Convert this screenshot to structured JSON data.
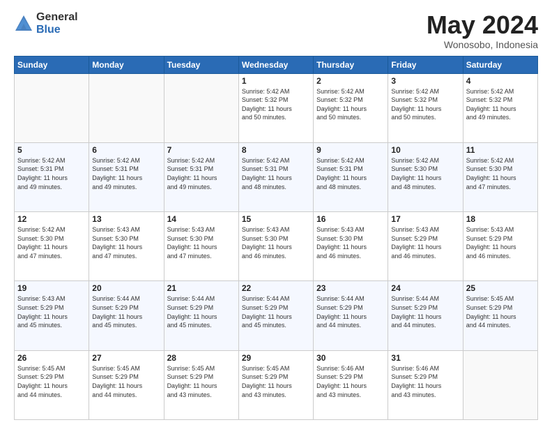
{
  "logo": {
    "general": "General",
    "blue": "Blue"
  },
  "header": {
    "month": "May 2024",
    "location": "Wonosobo, Indonesia"
  },
  "weekdays": [
    "Sunday",
    "Monday",
    "Tuesday",
    "Wednesday",
    "Thursday",
    "Friday",
    "Saturday"
  ],
  "weeks": [
    [
      {
        "day": "",
        "info": ""
      },
      {
        "day": "",
        "info": ""
      },
      {
        "day": "",
        "info": ""
      },
      {
        "day": "1",
        "info": "Sunrise: 5:42 AM\nSunset: 5:32 PM\nDaylight: 11 hours\nand 50 minutes."
      },
      {
        "day": "2",
        "info": "Sunrise: 5:42 AM\nSunset: 5:32 PM\nDaylight: 11 hours\nand 50 minutes."
      },
      {
        "day": "3",
        "info": "Sunrise: 5:42 AM\nSunset: 5:32 PM\nDaylight: 11 hours\nand 50 minutes."
      },
      {
        "day": "4",
        "info": "Sunrise: 5:42 AM\nSunset: 5:32 PM\nDaylight: 11 hours\nand 49 minutes."
      }
    ],
    [
      {
        "day": "5",
        "info": "Sunrise: 5:42 AM\nSunset: 5:31 PM\nDaylight: 11 hours\nand 49 minutes."
      },
      {
        "day": "6",
        "info": "Sunrise: 5:42 AM\nSunset: 5:31 PM\nDaylight: 11 hours\nand 49 minutes."
      },
      {
        "day": "7",
        "info": "Sunrise: 5:42 AM\nSunset: 5:31 PM\nDaylight: 11 hours\nand 49 minutes."
      },
      {
        "day": "8",
        "info": "Sunrise: 5:42 AM\nSunset: 5:31 PM\nDaylight: 11 hours\nand 48 minutes."
      },
      {
        "day": "9",
        "info": "Sunrise: 5:42 AM\nSunset: 5:31 PM\nDaylight: 11 hours\nand 48 minutes."
      },
      {
        "day": "10",
        "info": "Sunrise: 5:42 AM\nSunset: 5:30 PM\nDaylight: 11 hours\nand 48 minutes."
      },
      {
        "day": "11",
        "info": "Sunrise: 5:42 AM\nSunset: 5:30 PM\nDaylight: 11 hours\nand 47 minutes."
      }
    ],
    [
      {
        "day": "12",
        "info": "Sunrise: 5:42 AM\nSunset: 5:30 PM\nDaylight: 11 hours\nand 47 minutes."
      },
      {
        "day": "13",
        "info": "Sunrise: 5:43 AM\nSunset: 5:30 PM\nDaylight: 11 hours\nand 47 minutes."
      },
      {
        "day": "14",
        "info": "Sunrise: 5:43 AM\nSunset: 5:30 PM\nDaylight: 11 hours\nand 47 minutes."
      },
      {
        "day": "15",
        "info": "Sunrise: 5:43 AM\nSunset: 5:30 PM\nDaylight: 11 hours\nand 46 minutes."
      },
      {
        "day": "16",
        "info": "Sunrise: 5:43 AM\nSunset: 5:30 PM\nDaylight: 11 hours\nand 46 minutes."
      },
      {
        "day": "17",
        "info": "Sunrise: 5:43 AM\nSunset: 5:29 PM\nDaylight: 11 hours\nand 46 minutes."
      },
      {
        "day": "18",
        "info": "Sunrise: 5:43 AM\nSunset: 5:29 PM\nDaylight: 11 hours\nand 46 minutes."
      }
    ],
    [
      {
        "day": "19",
        "info": "Sunrise: 5:43 AM\nSunset: 5:29 PM\nDaylight: 11 hours\nand 45 minutes."
      },
      {
        "day": "20",
        "info": "Sunrise: 5:44 AM\nSunset: 5:29 PM\nDaylight: 11 hours\nand 45 minutes."
      },
      {
        "day": "21",
        "info": "Sunrise: 5:44 AM\nSunset: 5:29 PM\nDaylight: 11 hours\nand 45 minutes."
      },
      {
        "day": "22",
        "info": "Sunrise: 5:44 AM\nSunset: 5:29 PM\nDaylight: 11 hours\nand 45 minutes."
      },
      {
        "day": "23",
        "info": "Sunrise: 5:44 AM\nSunset: 5:29 PM\nDaylight: 11 hours\nand 44 minutes."
      },
      {
        "day": "24",
        "info": "Sunrise: 5:44 AM\nSunset: 5:29 PM\nDaylight: 11 hours\nand 44 minutes."
      },
      {
        "day": "25",
        "info": "Sunrise: 5:45 AM\nSunset: 5:29 PM\nDaylight: 11 hours\nand 44 minutes."
      }
    ],
    [
      {
        "day": "26",
        "info": "Sunrise: 5:45 AM\nSunset: 5:29 PM\nDaylight: 11 hours\nand 44 minutes."
      },
      {
        "day": "27",
        "info": "Sunrise: 5:45 AM\nSunset: 5:29 PM\nDaylight: 11 hours\nand 44 minutes."
      },
      {
        "day": "28",
        "info": "Sunrise: 5:45 AM\nSunset: 5:29 PM\nDaylight: 11 hours\nand 43 minutes."
      },
      {
        "day": "29",
        "info": "Sunrise: 5:45 AM\nSunset: 5:29 PM\nDaylight: 11 hours\nand 43 minutes."
      },
      {
        "day": "30",
        "info": "Sunrise: 5:46 AM\nSunset: 5:29 PM\nDaylight: 11 hours\nand 43 minutes."
      },
      {
        "day": "31",
        "info": "Sunrise: 5:46 AM\nSunset: 5:29 PM\nDaylight: 11 hours\nand 43 minutes."
      },
      {
        "day": "",
        "info": ""
      }
    ]
  ]
}
